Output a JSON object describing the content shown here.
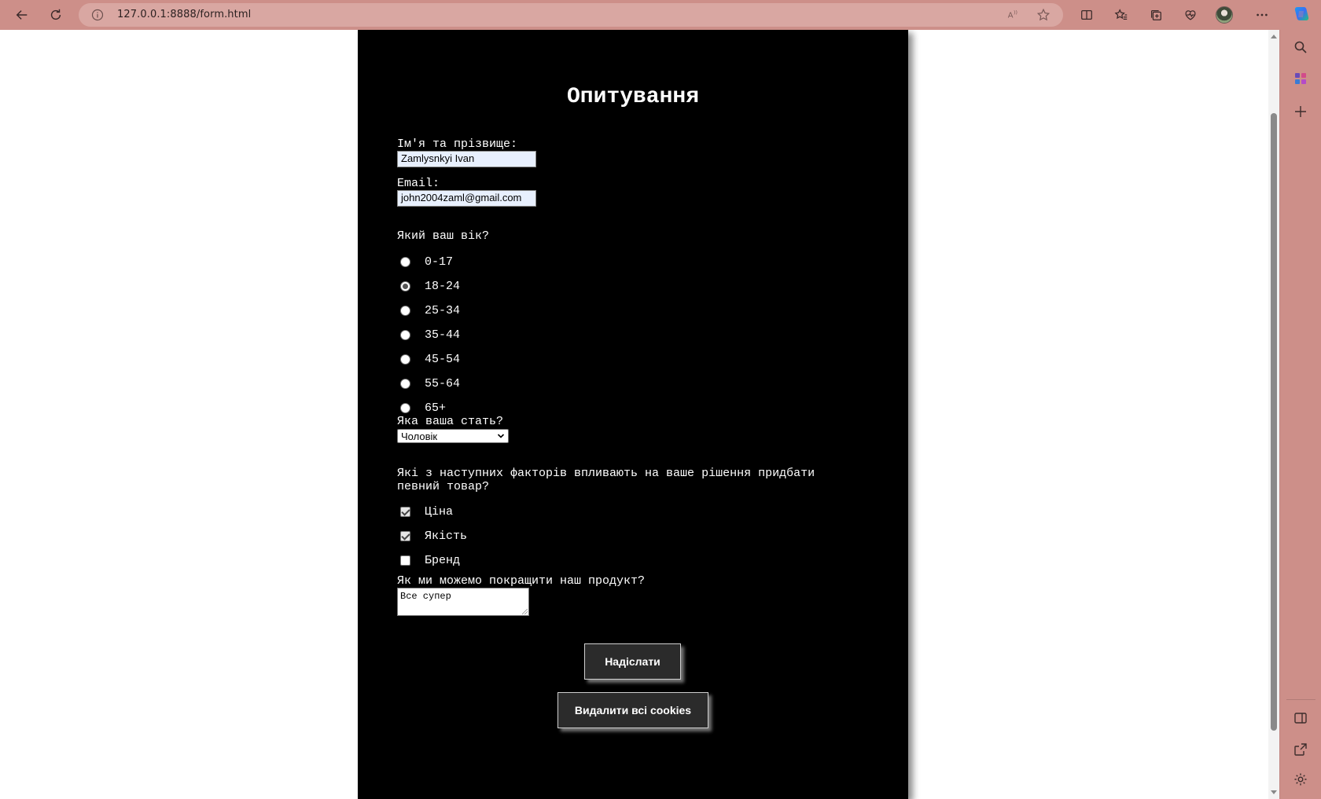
{
  "browser": {
    "url": "127.0.0.1:8888/form.html",
    "toolbar_color": "#cd8f89",
    "icons": [
      "back-icon",
      "refresh-icon",
      "site-info-icon",
      "read-aloud-icon",
      "favorite-star-icon",
      "split-screen-icon",
      "favorites-icon",
      "collections-icon",
      "browser-essentials-icon",
      "profile-avatar",
      "more-menu-icon",
      "copilot-icon"
    ],
    "sidebar_icons": [
      "search-icon",
      "apps-icon",
      "add-icon",
      "sidebar-layout-icon",
      "open-external-icon",
      "settings-icon"
    ]
  },
  "form": {
    "title": "Опитування",
    "name_label": "Ім'я та прізвище:",
    "name_value": "Zamlysnkyi Ivan",
    "email_label": "Email:",
    "email_value": "john2004zaml@gmail.com",
    "age_question": "Який ваш вік?",
    "age_options": [
      {
        "label": "0-17",
        "selected": false
      },
      {
        "label": "18-24",
        "selected": true
      },
      {
        "label": "25-34",
        "selected": false
      },
      {
        "label": "35-44",
        "selected": false
      },
      {
        "label": "45-54",
        "selected": false
      },
      {
        "label": "55-64",
        "selected": false
      },
      {
        "label": "65+",
        "selected": false
      }
    ],
    "gender_question": "Яка ваша стать?",
    "gender_value": "Чоловік",
    "factors_question": "Які з наступних факторів впливають на ваше рішення придбати певний товар?",
    "factors_question_line1": "Які з наступних факторів впливають на ваше рішення придбати",
    "factors_question_line2": "певний товар?",
    "factor_options": [
      {
        "label": "Ціна",
        "checked": true
      },
      {
        "label": "Якість",
        "checked": true
      },
      {
        "label": "Бренд",
        "checked": false
      }
    ],
    "improve_question": "Як ми можемо покращити наш продукт?",
    "improve_value": "Все супер",
    "submit_label": "Надіслати",
    "delete_cookies_label": "Видалити всі cookies"
  }
}
